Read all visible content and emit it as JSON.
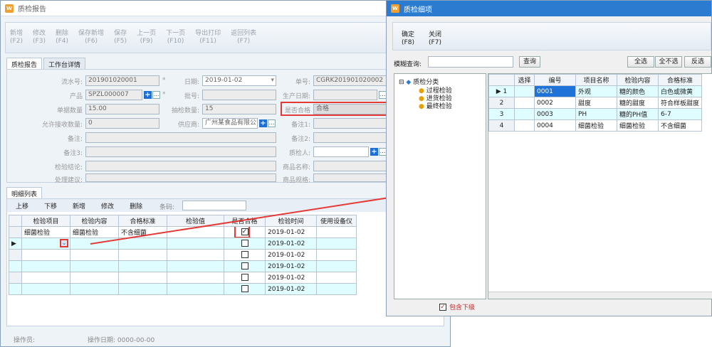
{
  "main": {
    "title": "质检报告",
    "toolbar": [
      {
        "label": "新增",
        "key": "(F2)"
      },
      {
        "label": "修改",
        "key": "(F3)"
      },
      {
        "label": "删除",
        "key": "(F4)"
      },
      {
        "label": "保存新增",
        "key": "(F6)"
      },
      {
        "label": "保存",
        "key": "(F5)"
      },
      {
        "label": "上一页",
        "key": "(F9)"
      },
      {
        "label": "下一页",
        "key": "(F10)"
      },
      {
        "label": "导出打印",
        "key": "(F11)"
      },
      {
        "label": "返回列表",
        "key": "(F7)"
      }
    ],
    "tabs": [
      "质检报告",
      "工作台详情"
    ],
    "form": {
      "serial_label": "流水号:",
      "serial": "201901020001",
      "date_label": "日期:",
      "date": "2019-01-02",
      "order_label": "单号:",
      "order": "CGRK201901020002",
      "product_label": "产品",
      "product": "SPZL000007",
      "batch_label": "批号:",
      "batch": "",
      "mfg_label": "生产日期:",
      "mfg": "",
      "qty_label": "单据数量",
      "qty": "15.00",
      "sample_label": "抽检数量:",
      "sample": "15",
      "pass_label": "是否合格",
      "pass": "合格",
      "accept_label": "允许接收数量:",
      "accept": "0",
      "supplier_label": "供应商:",
      "supplier": "广州某食品有限公司",
      "note1_label": "备注1:",
      "remark_label": "备注:",
      "note2_label": "备注2:",
      "remark3_label": "备注3:",
      "inspector_label": "质检人:",
      "conclusion_label": "检验结论:",
      "goods_name_label": "商品名称:",
      "suggest_label": "处理建议:",
      "goods_spec_label": "商品规格:",
      "star": "*"
    },
    "detail_tab": "明细列表",
    "detail_toolbar": [
      "上移",
      "下移",
      "新增",
      "修改",
      "删除"
    ],
    "barcode_label": "条码:",
    "detail_headers": [
      "检验项目",
      "检验内容",
      "合格标准",
      "检验值",
      "是否合格",
      "检验时间",
      "使用设备仪"
    ],
    "detail_rows": [
      {
        "item": "细菌检验",
        "content": "细菌检验",
        "std": "不含细菌",
        "val": "",
        "ok": true,
        "time": "2019-01-02"
      },
      {
        "item": "",
        "content": "",
        "std": "",
        "val": "",
        "ok": false,
        "time": "2019-01-02"
      },
      {
        "item": "",
        "content": "",
        "std": "",
        "val": "",
        "ok": false,
        "time": "2019-01-02"
      },
      {
        "item": "",
        "content": "",
        "std": "",
        "val": "",
        "ok": false,
        "time": "2019-01-02"
      },
      {
        "item": "",
        "content": "",
        "std": "",
        "val": "",
        "ok": false,
        "time": "2019-01-02"
      },
      {
        "item": "",
        "content": "",
        "std": "",
        "val": "",
        "ok": false,
        "time": "2019-01-02"
      }
    ],
    "footer": {
      "operator_label": "操作员:",
      "opdate_label": "操作日期:",
      "opdate": "0000-00-00"
    }
  },
  "dialog": {
    "title": "质检细项",
    "confirm": "确定",
    "confirm_key": "(F8)",
    "close": "关闭",
    "close_key": "(F7)",
    "search_label": "模糊查询:",
    "search_btn": "查询",
    "select_all": "全选",
    "select_none": "全不选",
    "invert": "反选",
    "tree_root": "质检分类",
    "tree_children": [
      "过程检验",
      "进货检验",
      "最终检验"
    ],
    "headers": [
      "选择",
      "编号",
      "项目名称",
      "检验内容",
      "合格标准"
    ],
    "rows": [
      {
        "n": "1",
        "code": "0001",
        "name": "外观",
        "content": "糖的颜色",
        "std": "白色或微黄"
      },
      {
        "n": "2",
        "code": "0002",
        "name": "甜度",
        "content": "糖的甜度",
        "std": "符合样板甜度"
      },
      {
        "n": "3",
        "code": "0003",
        "name": "PH",
        "content": "糖的PH值",
        "std": "6-7"
      },
      {
        "n": "4",
        "code": "0004",
        "name": "细菌检验",
        "content": "细菌检验",
        "std": "不含细菌"
      }
    ],
    "include_sub": "包含下级"
  },
  "colors": {
    "accent": "#2b7bd1",
    "highlight": "#e53935",
    "alt_row": "#dffcff"
  }
}
